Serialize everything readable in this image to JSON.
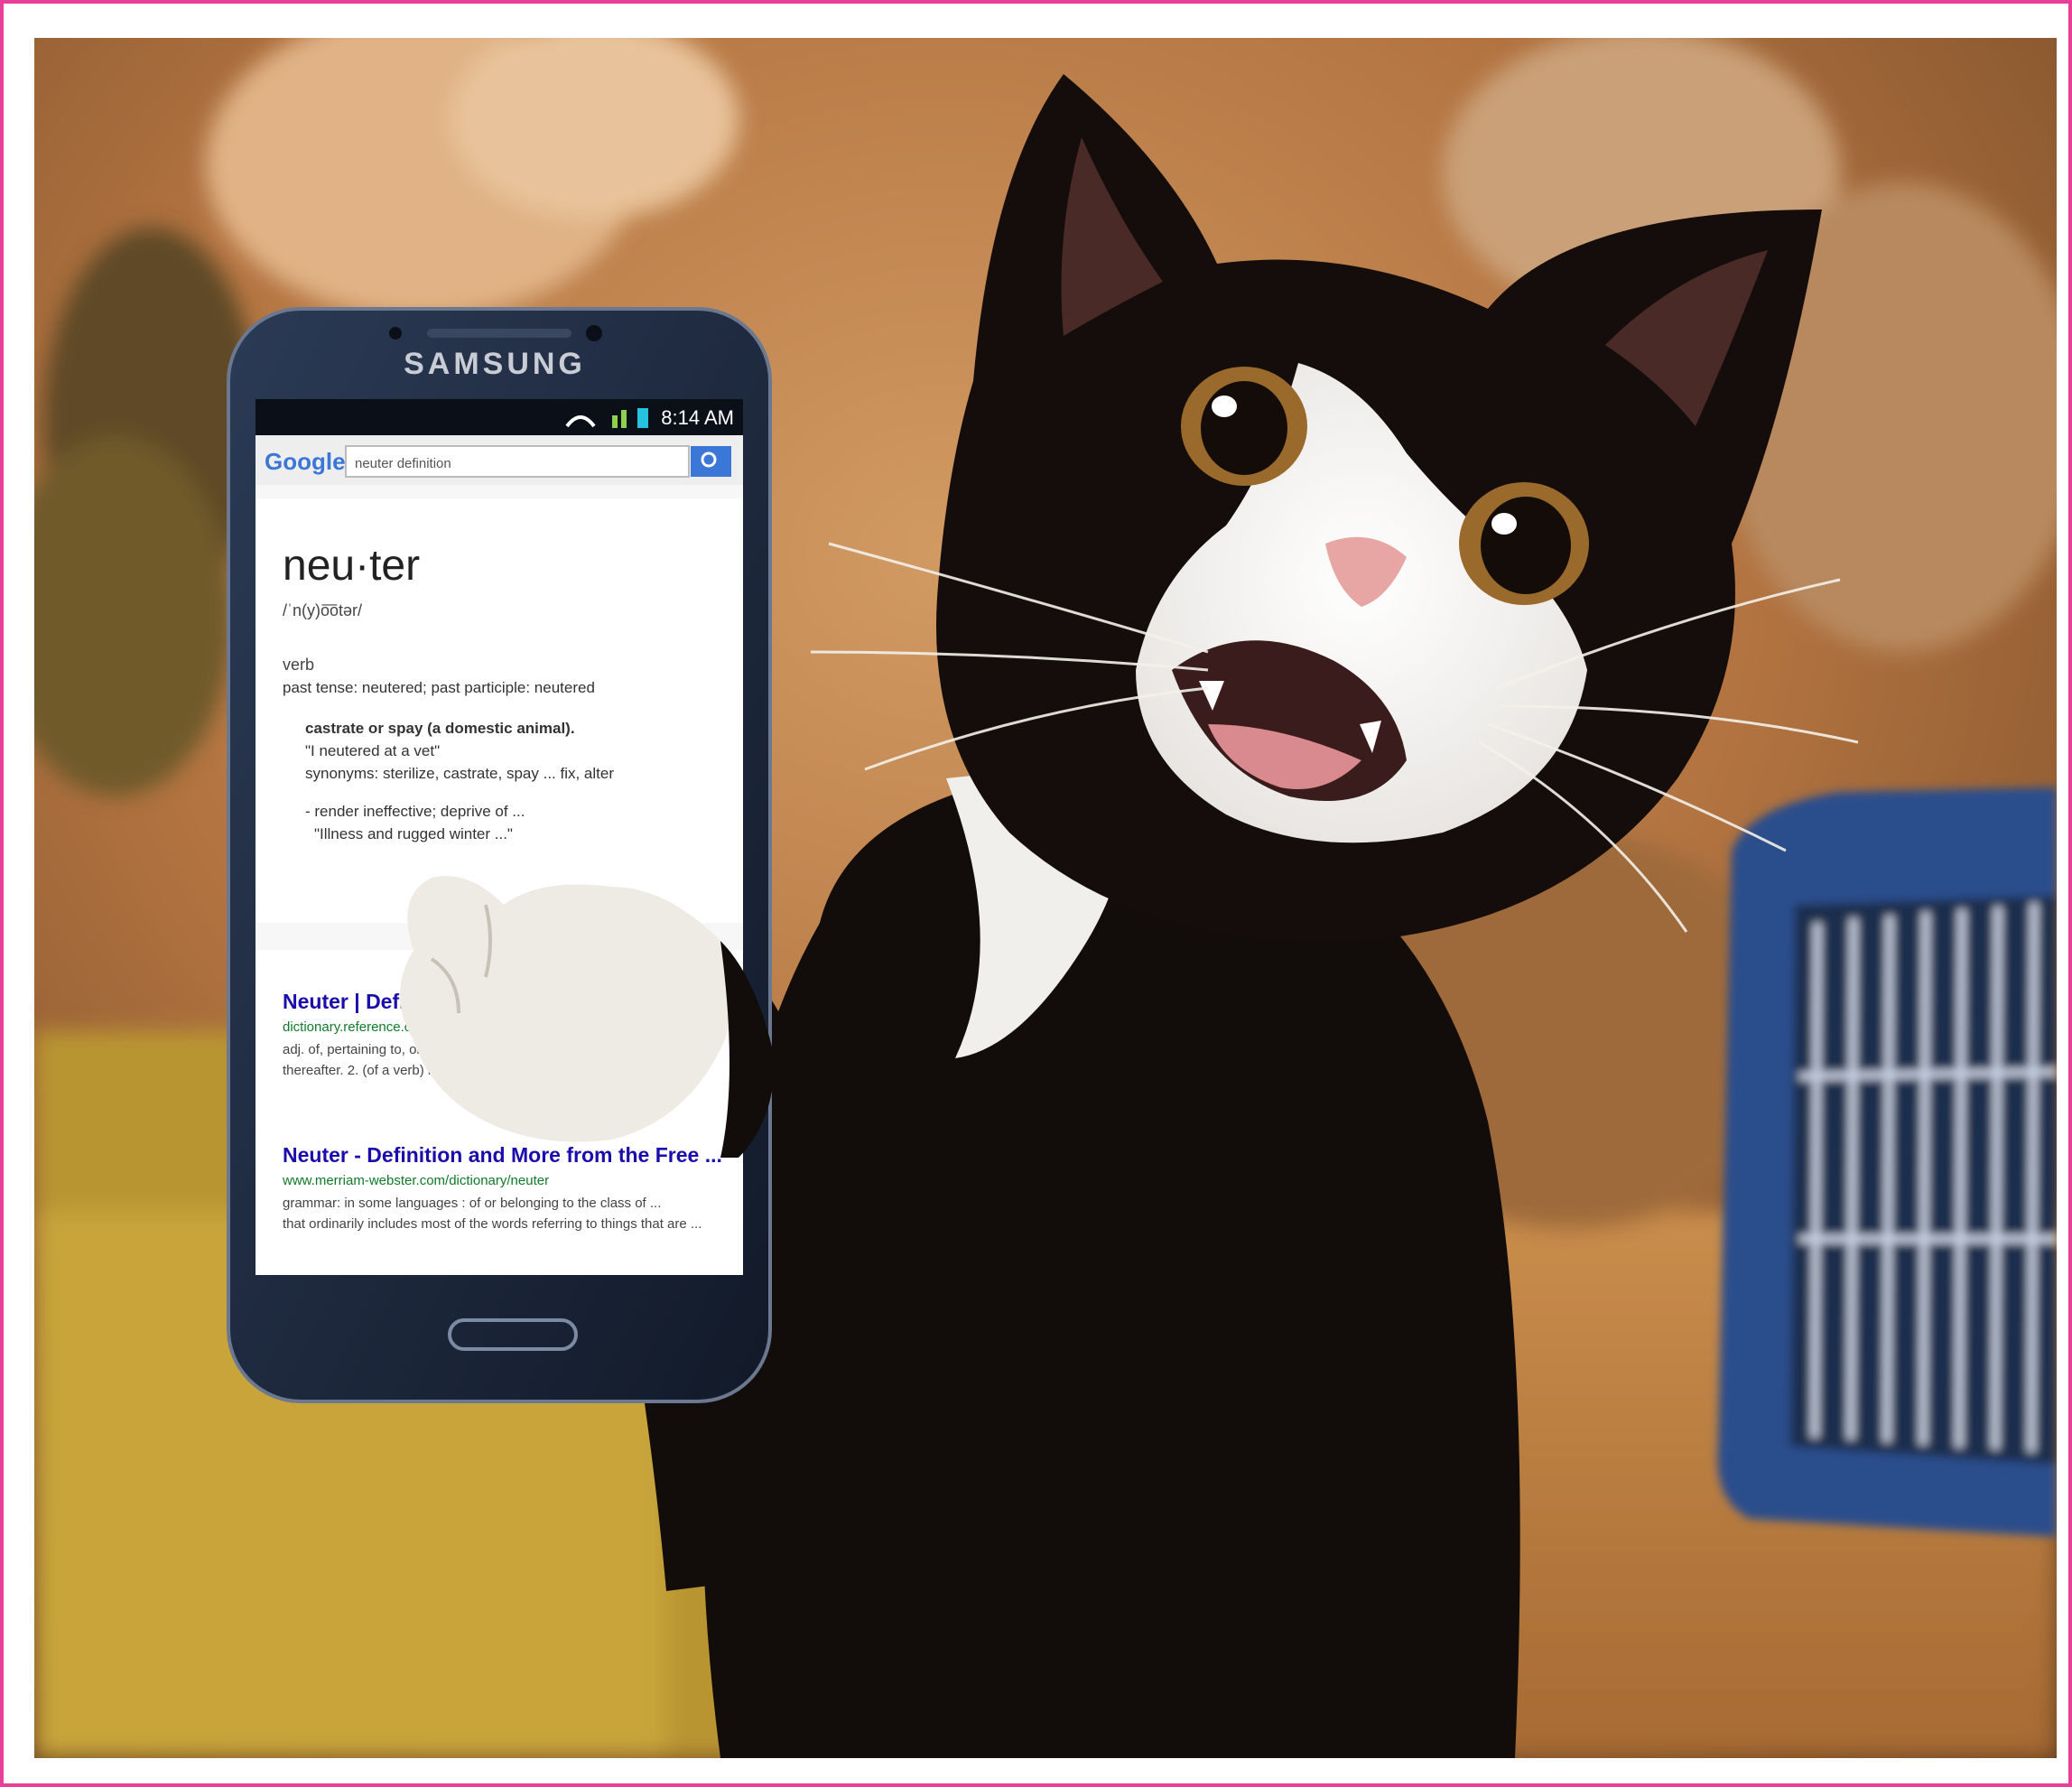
{
  "phone": {
    "brand": "SAMSUNG",
    "status_time": "8:14 AM",
    "search_logo": "Google",
    "search_query": "neuter definition",
    "definition": {
      "word": "neu·ter",
      "pronunciation": "/ˈn(y)o͞otər/",
      "part_of_speech": "verb",
      "tenses": "past tense: neutered; past participle: neutered",
      "sense_1": "castrate or spay (a domestic animal).",
      "example": "\"I neutered at a vet\"",
      "synonyms": "synonyms: sterilize, castrate, spay ... fix, alter",
      "sense_2": "- render ineffective; deprive of ...",
      "example_2": "\"Illness and rugged winter ...\""
    },
    "results": [
      {
        "title": "Neuter | Define ...",
        "url": "dictionary.reference.com/...",
        "snippet_1": "adj. of, pertaining to, or a gender of ...",
        "snippet_2": "thereafter. 2. (of a verb) intransitive. 2. Biology ..."
      },
      {
        "title": "Neuter - Definition and More from the Free ...",
        "url": "www.merriam-webster.com/dictionary/neuter",
        "snippet_1": "grammar: in some languages : of or belonging to the class of ...",
        "snippet_2": "that ordinarily includes most of the words referring to things that are ..."
      }
    ]
  },
  "colors": {
    "frame_border": "#e8409a",
    "phone_body": "#1c2537",
    "search_button": "#3b77d6",
    "link_blue": "#1a0dab",
    "url_green": "#107a28"
  },
  "icons": [
    "samsung-phone",
    "cat",
    "pet-carrier",
    "search-icon",
    "wifi-icon",
    "signal-icon",
    "battery-icon"
  ]
}
